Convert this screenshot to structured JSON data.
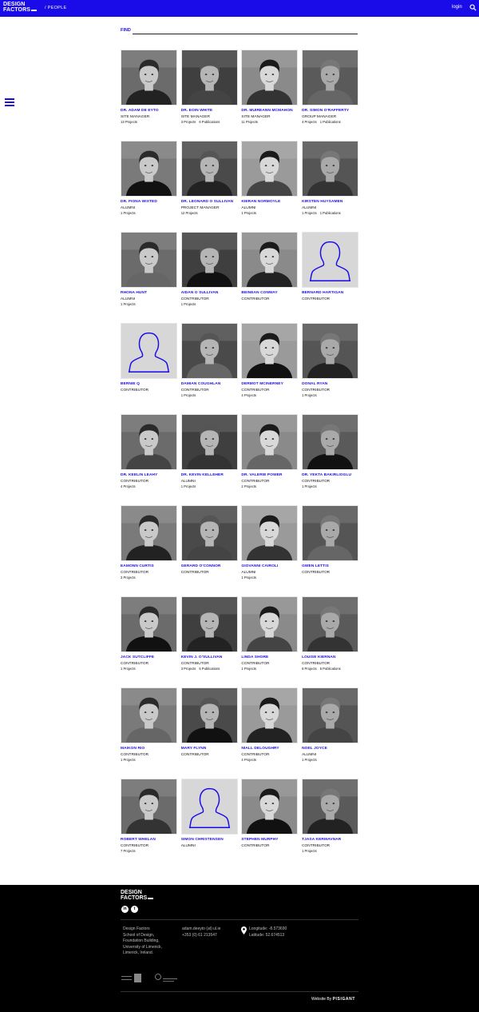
{
  "header": {
    "logo_line1": "DESIGN",
    "logo_line2": "FACTORS",
    "breadcrumb": "/ PEOPLE",
    "login_label": "login",
    "accent_color": "#1a0ce8",
    "search_icon": "search-icon",
    "menu_icon": "hamburger-menu-icon"
  },
  "search": {
    "label": "FIND",
    "value": "",
    "placeholder": ""
  },
  "people": [
    {
      "name": "DR. ADAM DE EYTO",
      "role": "SITE MANAGER",
      "projects": "13 Projects",
      "publications": ""
    },
    {
      "name": "DR. EOIN WHITE",
      "role": "SITE MANAGER",
      "projects": "3 Projects",
      "publications": "6 Publications"
    },
    {
      "name": "DR. MUIREANN MCMAHON",
      "role": "SITE MANAGER",
      "projects": "11 Projects",
      "publications": ""
    },
    {
      "name": "DR. SIMON O'RAFFERTY",
      "role": "GROUP MANAGER",
      "projects": "4 Projects",
      "publications": "1 Publications"
    },
    {
      "name": "DR. FIONA WIXTED",
      "role": "ALUMNI",
      "projects": "1 Projects",
      "publications": ""
    },
    {
      "name": "DR. LEONARD O SULLIVAN",
      "role": "PROJECT MANAGER",
      "projects": "12 Projects",
      "publications": ""
    },
    {
      "name": "KIERAN NORMOYLE",
      "role": "ALUMNI",
      "projects": "1 Projects",
      "publications": ""
    },
    {
      "name": "KIRSTEN HUYSAMEN",
      "role": "ALUMNI",
      "projects": "1 Projects",
      "publications": "1 Publications"
    },
    {
      "name": "RHONA HUNT",
      "role": "ALUMNI",
      "projects": "1 Projects",
      "publications": ""
    },
    {
      "name": "AIDAN O SULLIVAN",
      "role": "CONTRIBUTOR",
      "projects": "1 Projects",
      "publications": ""
    },
    {
      "name": "BEINEÁN CONWAY",
      "role": "CONTRIBUTOR",
      "projects": "",
      "publications": ""
    },
    {
      "name": "BERNARD HARTIGAN",
      "role": "CONTRIBUTOR",
      "projects": "",
      "publications": ""
    },
    {
      "name": "BERNIE Q",
      "role": "CONTRIBUTOR",
      "projects": "",
      "publications": ""
    },
    {
      "name": "DAMIAN COUGHLAN",
      "role": "CONTRIBUTOR",
      "projects": "1 Projects",
      "publications": ""
    },
    {
      "name": "DERMOT MCINERNEY",
      "role": "CONTRIBUTOR",
      "projects": "4 Projects",
      "publications": ""
    },
    {
      "name": "DONAL RYAN",
      "role": "CONTRIBUTOR",
      "projects": "1 Projects",
      "publications": ""
    },
    {
      "name": "DR. KEELIN LEAHY",
      "role": "CONTRIBUTOR",
      "projects": "4 Projects",
      "publications": ""
    },
    {
      "name": "DR. KEVIN KELLEHER",
      "role": "ALUMNI",
      "projects": "1 Projects",
      "publications": ""
    },
    {
      "name": "DR. VALERIE POWER",
      "role": "CONTRIBUTOR",
      "projects": "2 Projects",
      "publications": ""
    },
    {
      "name": "DR. YEKTA BAKIRLIOĞLU",
      "role": "CONTRIBUTOR",
      "projects": "1 Projects",
      "publications": ""
    },
    {
      "name": "EAMONN CURTIS",
      "role": "CONTRIBUTOR",
      "projects": "3 Projects",
      "publications": ""
    },
    {
      "name": "GERARD O'CONNOR",
      "role": "CONTRIBUTOR",
      "projects": "",
      "publications": ""
    },
    {
      "name": "GIOVANNI CAIROLI",
      "role": "ALUMNI",
      "projects": "1 Projects",
      "publications": ""
    },
    {
      "name": "GWEN LETTIS",
      "role": "CONTRIBUTOR",
      "projects": "",
      "publications": ""
    },
    {
      "name": "JACK SUTCLIFFE",
      "role": "CONTRIBUTOR",
      "projects": "1 Projects",
      "publications": ""
    },
    {
      "name": "KEVIN J. O'SULLIVAN",
      "role": "CONTRIBUTOR",
      "projects": "3 Projects",
      "publications": "5 Publications"
    },
    {
      "name": "LINDA SHORE",
      "role": "CONTRIBUTOR",
      "projects": "1 Projects",
      "publications": ""
    },
    {
      "name": "LOUISE KIERNAN",
      "role": "CONTRIBUTOR",
      "projects": "6 Projects",
      "publications": "6 Publications"
    },
    {
      "name": "MAIKON RIO",
      "role": "CONTRIBUTOR",
      "projects": "1 Projects",
      "publications": ""
    },
    {
      "name": "MARY FLYNN",
      "role": "CONTRIBUTOR",
      "projects": "",
      "publications": ""
    },
    {
      "name": "NIALL DELOUGHRY",
      "role": "CONTRIBUTOR",
      "projects": "4 Projects",
      "publications": ""
    },
    {
      "name": "NOEL JOYCE",
      "role": "ALUMNI",
      "projects": "1 Projects",
      "publications": ""
    },
    {
      "name": "ROBERT WHELAN",
      "role": "CONTRIBUTOR",
      "projects": "7 Projects",
      "publications": ""
    },
    {
      "name": "SIMON CHRISTENSEN",
      "role": "ALUMNI",
      "projects": "",
      "publications": ""
    },
    {
      "name": "STEPHEN MURPHY",
      "role": "CONTRIBUTOR",
      "projects": "",
      "publications": ""
    },
    {
      "name": "TJAŠA KERMAVNAR",
      "role": "CONTRIBUTOR",
      "projects": "1 Projects",
      "publications": ""
    }
  ],
  "footer": {
    "logo_line1": "DESIGN",
    "logo_line2": "FACTORS",
    "social": [
      "linkedin-icon",
      "twitter-icon"
    ],
    "address": [
      "Design Factors",
      "School of Design,",
      "Foundation Building,",
      "University of Limerick,",
      "Limerick, Ireland."
    ],
    "email": "adam.deeyto (at) ul.ie",
    "phone": "+353 (0) 61 213547",
    "longitude": "Longitude: -8.573690",
    "latitude": "Latitude: 52.674513",
    "credit_prefix": "Website By",
    "credit_brand": "PISIGANT"
  }
}
